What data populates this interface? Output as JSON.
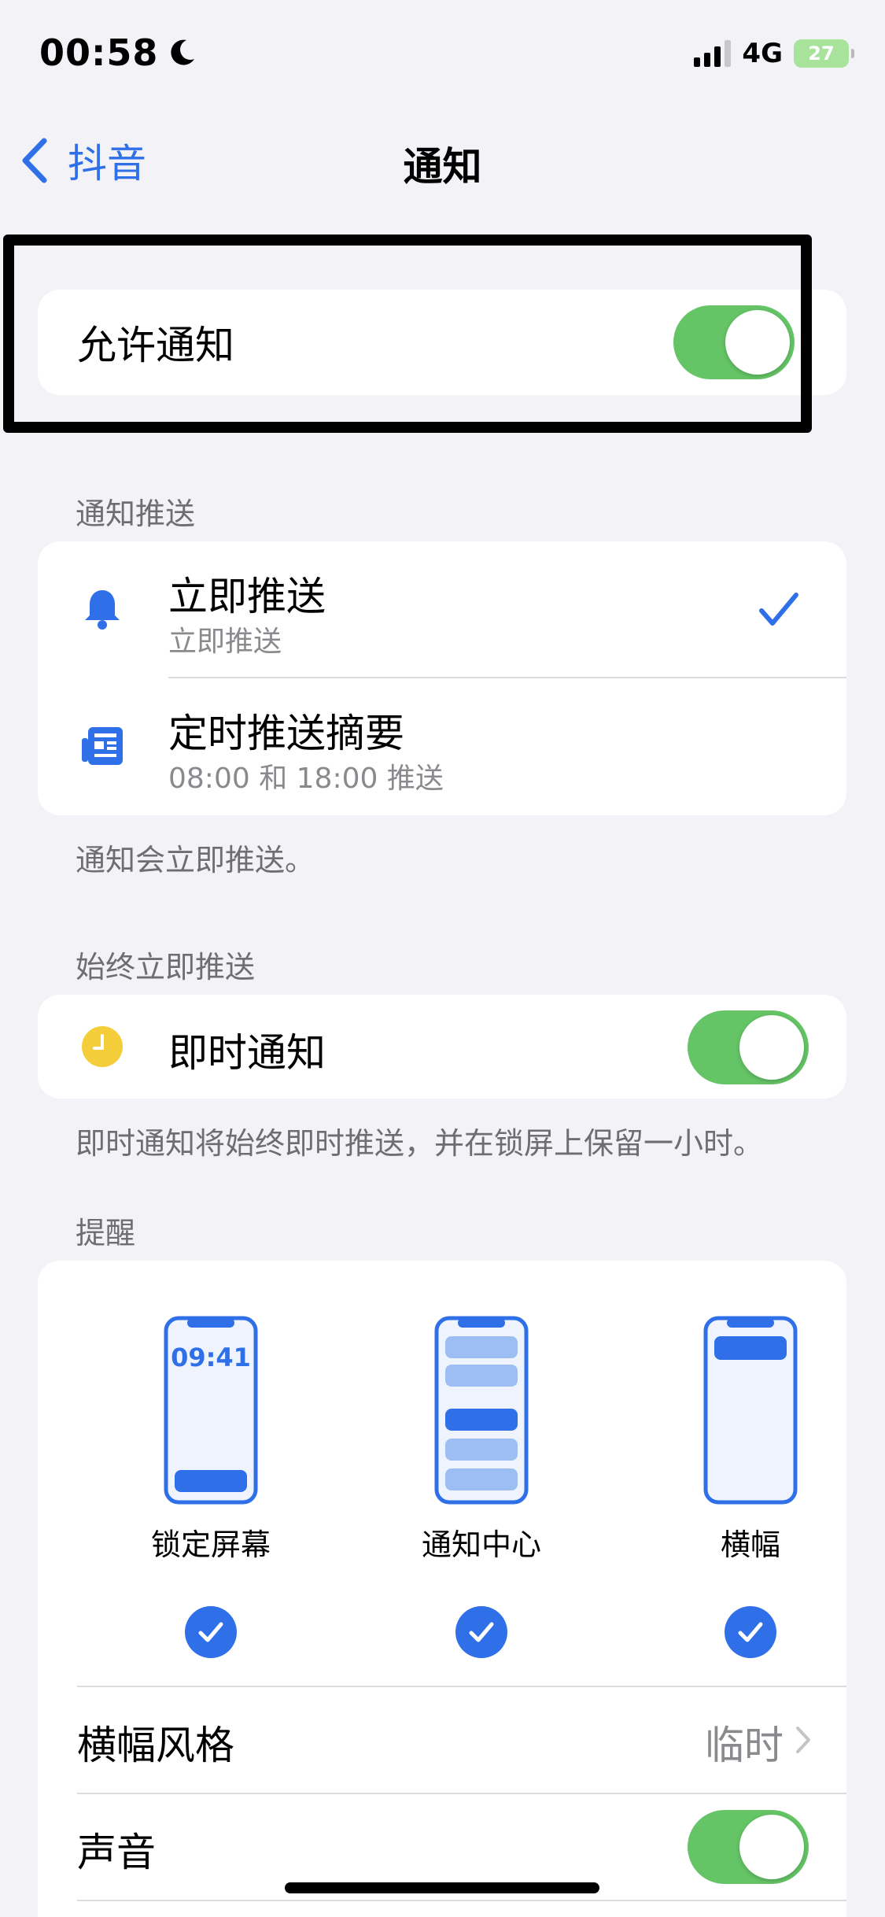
{
  "status_bar": {
    "time": "00:58",
    "network": "4G",
    "battery": "27"
  },
  "nav": {
    "back_label": "抖音",
    "title": "通知"
  },
  "allow": {
    "label": "允许通知",
    "on": true
  },
  "delivery": {
    "header": "通知推送",
    "items": [
      {
        "title": "立即推送",
        "subtitle": "立即推送",
        "selected": true
      },
      {
        "title": "定时推送摘要",
        "subtitle": "08:00 和 18:00 推送",
        "selected": false
      }
    ],
    "footnote": "通知会立即推送。"
  },
  "always": {
    "header": "始终立即推送",
    "label": "即时通知",
    "on": true,
    "footnote": "即时通知将始终即时推送，并在锁屏上保留一小时。"
  },
  "alerts": {
    "header": "提醒",
    "options": [
      {
        "label": "锁定屏幕",
        "preview_time": "09:41",
        "checked": true
      },
      {
        "label": "通知中心",
        "checked": true
      },
      {
        "label": "横幅",
        "checked": true
      }
    ],
    "banner_style": {
      "label": "横幅风格",
      "value": "临时"
    },
    "sound": {
      "label": "声音",
      "on": true
    }
  },
  "colors": {
    "accent": "#2f6fe8",
    "toggle_on": "#65c466",
    "background": "#f2f2f7"
  }
}
